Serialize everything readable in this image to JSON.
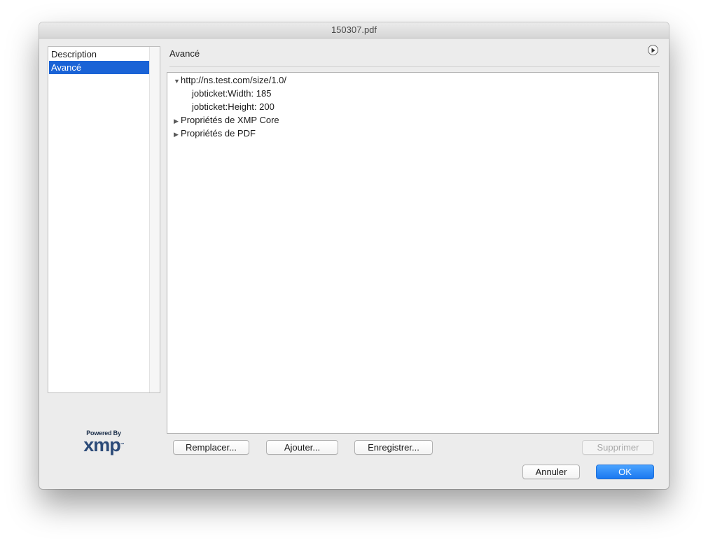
{
  "window": {
    "title": "150307.pdf"
  },
  "sidebar": {
    "items": [
      {
        "label": "Description",
        "selected": false
      },
      {
        "label": "Avancé",
        "selected": true
      }
    ]
  },
  "logo": {
    "powered_by": "Powered By",
    "brand": "xmp",
    "trademark": "™"
  },
  "panel": {
    "title": "Avancé",
    "menu_icon": "circle-play-icon"
  },
  "tree": {
    "rows": [
      {
        "label": "http://ns.test.com/size/1.0/",
        "expander": "expanded",
        "depth": 0
      },
      {
        "label": "jobticket:Width: 185",
        "expander": "none",
        "depth": 1
      },
      {
        "label": "jobticket:Height: 200",
        "expander": "none",
        "depth": 1
      },
      {
        "label": "Propriétés de XMP Core",
        "expander": "collapsed",
        "depth": 0
      },
      {
        "label": "Propriétés de PDF",
        "expander": "collapsed",
        "depth": 0
      }
    ]
  },
  "actions": {
    "replace": "Remplacer...",
    "add": "Ajouter...",
    "save": "Enregistrer...",
    "delete": "Supprimer",
    "delete_enabled": false
  },
  "footer": {
    "cancel": "Annuler",
    "ok": "OK"
  },
  "colors": {
    "selection": "#1a63d6",
    "primary_button": "#1b78f0"
  }
}
